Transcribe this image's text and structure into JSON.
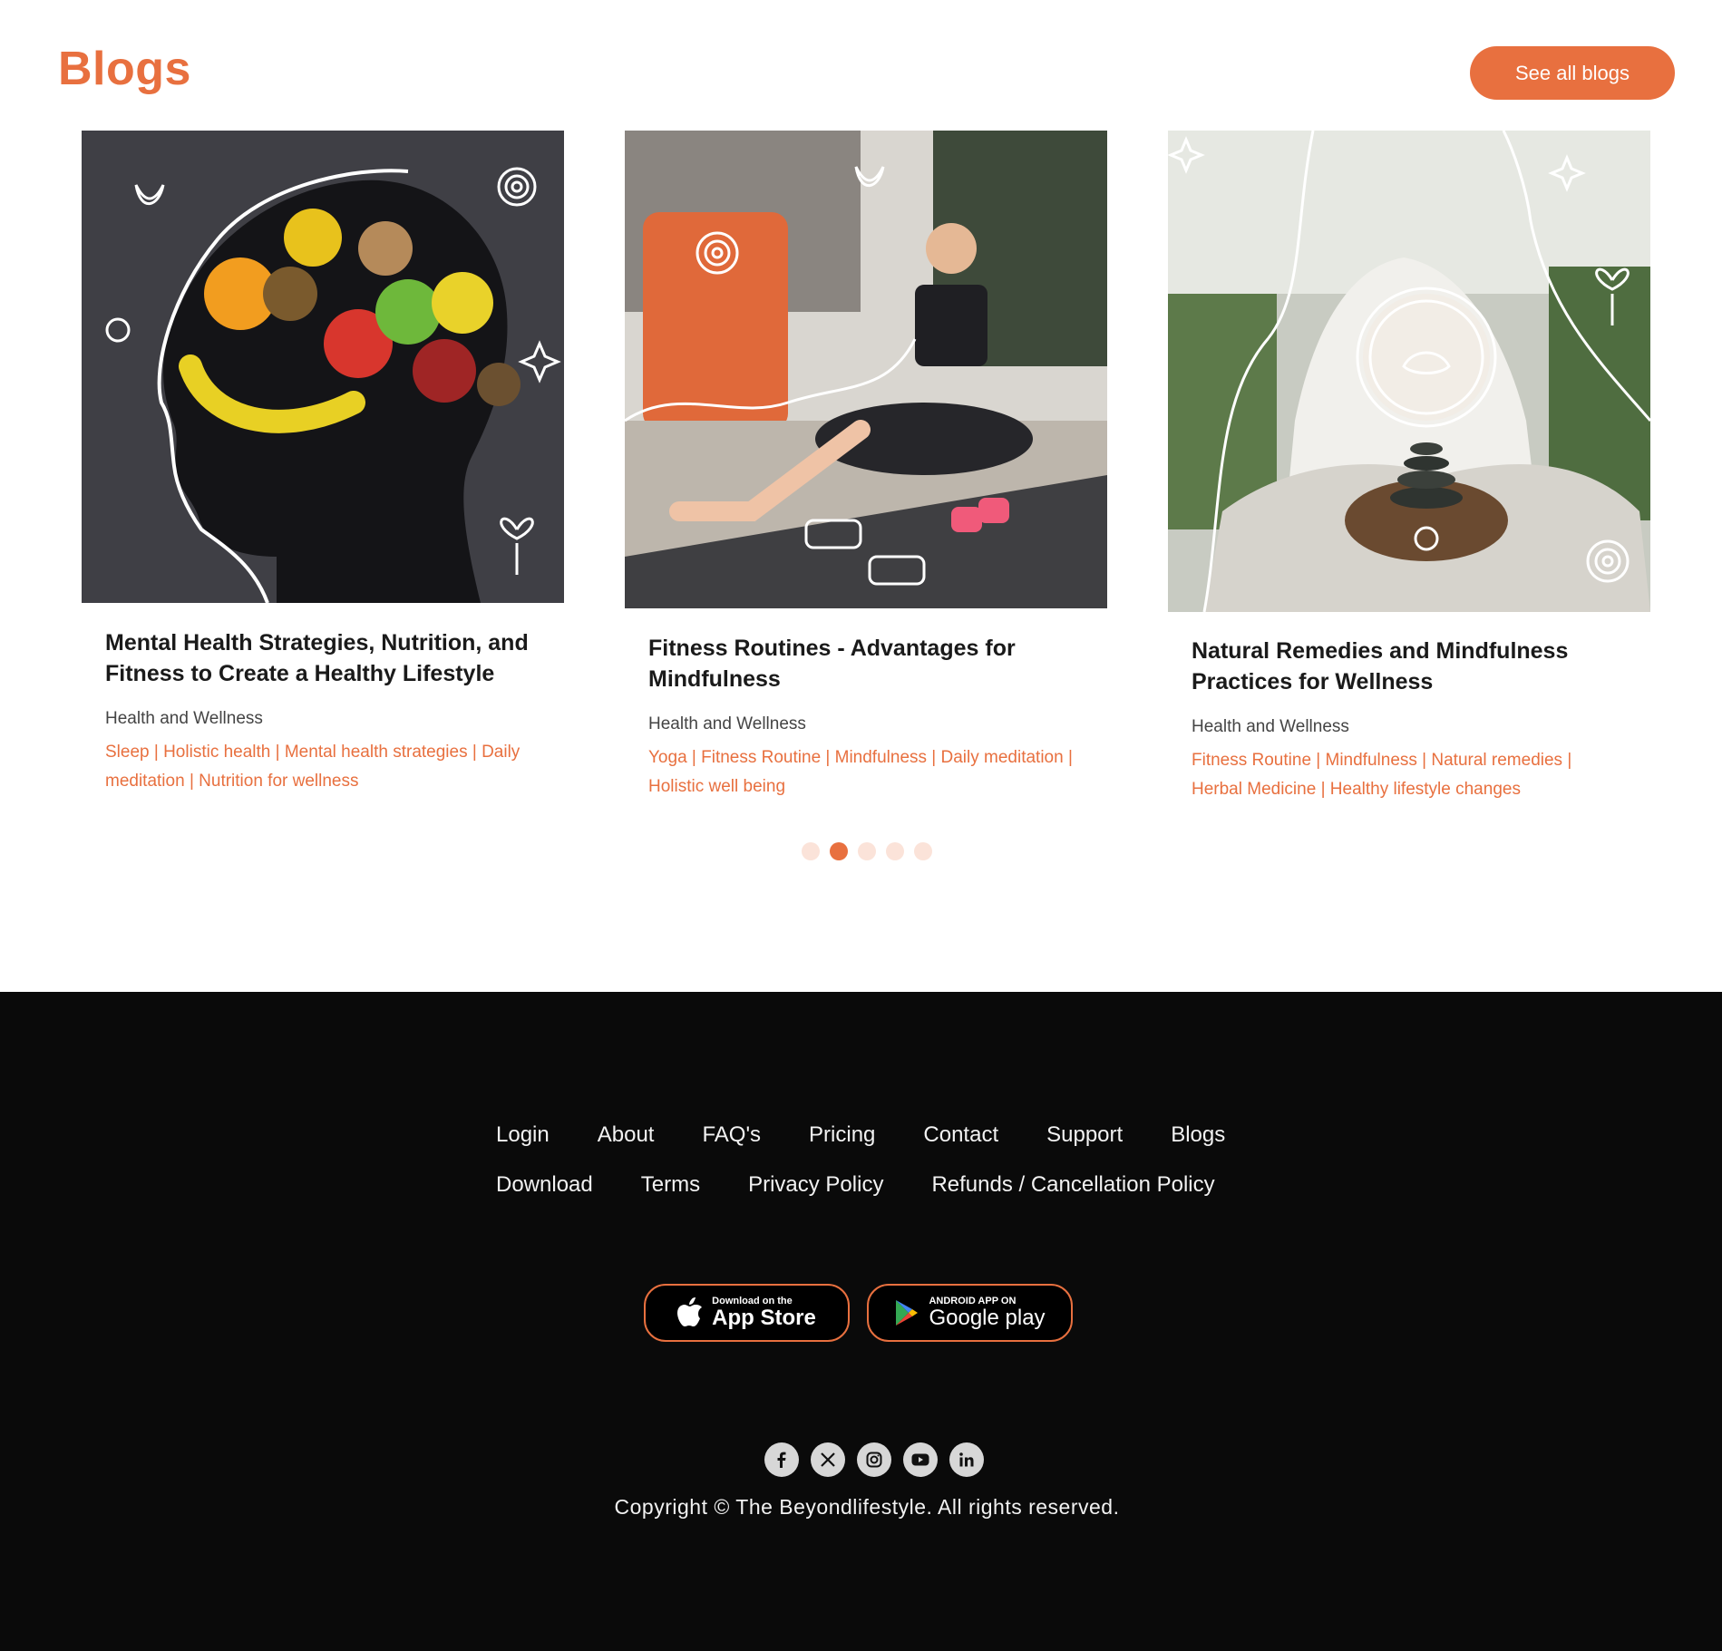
{
  "header": {
    "title": "Blogs",
    "see_all_label": "See all blogs"
  },
  "blogs": [
    {
      "title": "Mental Health Strategies, Nutrition, and Fitness to Create a Healthy Lifestyle",
      "category": "Health and Wellness",
      "tags": "Sleep | Holistic health | Mental health strategies | Daily meditation | Nutrition for wellness",
      "image": "head-silhouette-with-fruits-illustration"
    },
    {
      "title": "Fitness Routines - Advantages for Mindfulness",
      "category": "Health and Wellness",
      "tags": "Yoga | Fitness Routine | Mindfulness | Daily meditation | Holistic well being",
      "image": "woman-exercising-on-mat-illustration"
    },
    {
      "title": "Natural Remedies and Mindfulness Practices for Wellness",
      "category": "Health and Wellness",
      "tags": "Fitness Routine | Mindfulness | Natural remedies | Herbal Medicine | Healthy lifestyle changes",
      "image": "meditation-with-stones-illustration"
    }
  ],
  "pagination": {
    "total": 5,
    "active_index": 1
  },
  "footer": {
    "links_row1": [
      "Login",
      "About",
      "FAQ's",
      "Pricing",
      "Contact",
      "Support",
      "Blogs"
    ],
    "links_row2": [
      "Download",
      "Terms",
      "Privacy Policy",
      "Refunds / Cancellation Policy"
    ],
    "app_store": {
      "small": "Download on the",
      "big": "App Store"
    },
    "google_play": {
      "small": "ANDROID APP ON",
      "big": "Google play"
    },
    "socials": [
      "facebook-icon",
      "x-icon",
      "instagram-icon",
      "youtube-icon",
      "linkedin-icon"
    ],
    "copyright": "Copyright © The Beyondlifestyle. All rights reserved."
  },
  "colors": {
    "accent": "#e8703f",
    "dot_inactive": "#fbe3d9",
    "footer_bg": "#0a0a0a"
  }
}
